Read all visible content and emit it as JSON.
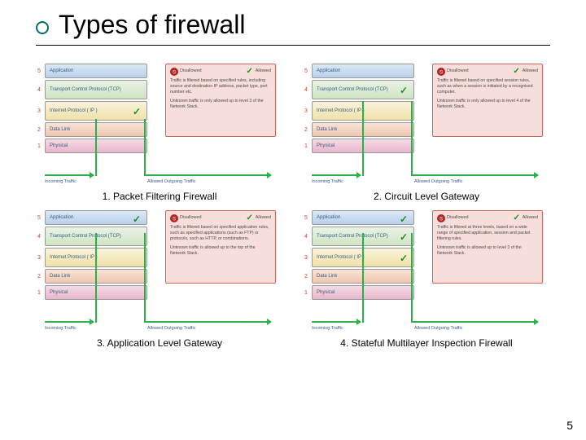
{
  "title": "Types of firewall",
  "slide_number": "5",
  "layers": {
    "l5": "Application",
    "l4": "Transport Control Protocol (TCP)",
    "l3": "Internet Protocol ( IP )",
    "l2": "Data Link",
    "l1": "Physical",
    "n5": "5",
    "n4": "4",
    "n3": "3",
    "n2": "2",
    "n1": "1"
  },
  "traffic": {
    "in": "Incoming Traffic",
    "out": "Allowed Outgoing Traffic"
  },
  "status": {
    "disallowed": "Disallowed",
    "allowed": "Allowed"
  },
  "figures": [
    {
      "caption": "1. Packet Filtering Firewall",
      "check_on": "l3",
      "body1": "Traffic is filtered based on specified rules, including source and destination IP address, packet type, port number etc.",
      "body2": "Unknown traffic is only allowed up to level 3 of the Network Stack."
    },
    {
      "caption": "2. Circuit Level Gateway",
      "check_on": "l4",
      "body1": "Traffic is filtered based on specified session rules, such as when a session is initiated by a recognised computer.",
      "body2": "Unknown traffic is only allowed up to level 4 of the Network Stack."
    },
    {
      "caption": "3. Application Level Gateway",
      "check_on": "l5",
      "body1": "Traffic is filtered based on specified application rules, such as specified applications (such as FTP) or protocols, such as HTTP, or combinations.",
      "body2": "Unknown traffic is allowed up to the top of the Network Stack."
    },
    {
      "caption": "4. Stateful Multilayer Inspection Firewall",
      "check_on": "all",
      "body1": "Traffic is filtered at three levels, based on a wide range of specified application, session and packet filtering rules.",
      "body2": "Unknown traffic is allowed up to level 3 of the Network Stack."
    }
  ]
}
